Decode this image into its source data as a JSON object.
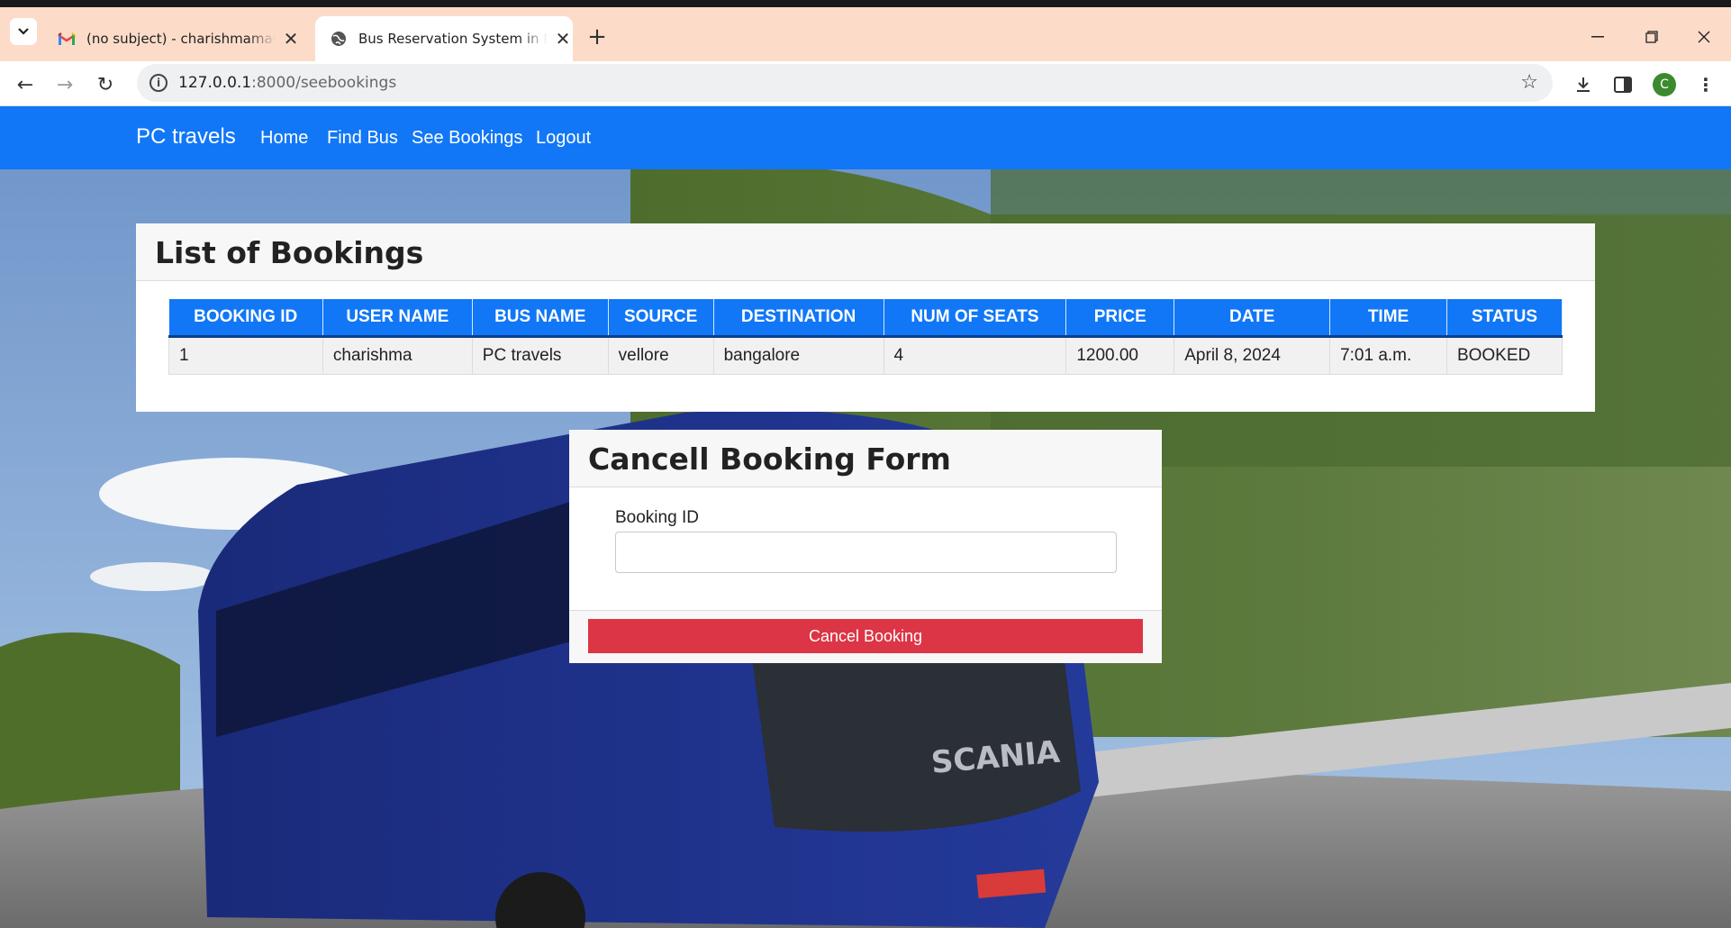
{
  "browser": {
    "tabs": [
      {
        "title": "(no subject) - charishmamasarap",
        "icon": "gmail-icon",
        "active": false
      },
      {
        "title": "Bus Reservation System in Django",
        "icon": "globe-icon",
        "active": true
      }
    ],
    "url_host": "127.0.0.1",
    "url_rest": ":8000/seebookings",
    "profile_initial": "C"
  },
  "nav": {
    "brand": "PC travels",
    "links": [
      "Home",
      "Find Bus",
      "See Bookings",
      "Logout"
    ]
  },
  "bookings": {
    "title": "List of Bookings",
    "columns": [
      "BOOKING ID",
      "USER NAME",
      "BUS NAME",
      "SOURCE",
      "DESTINATION",
      "NUM OF SEATS",
      "PRICE",
      "DATE",
      "TIME",
      "STATUS"
    ],
    "rows": [
      [
        "1",
        "charishma",
        "PC travels",
        "vellore",
        "bangalore",
        "4",
        "1200.00",
        "April 8, 2024",
        "7:01 a.m.",
        "BOOKED"
      ]
    ]
  },
  "cancel_form": {
    "title": "Cancell Booking Form",
    "field_label": "Booking ID",
    "field_value": "",
    "button_label": "Cancel Booking"
  },
  "colors": {
    "navbar": "#1177f7",
    "danger": "#dc3545"
  }
}
